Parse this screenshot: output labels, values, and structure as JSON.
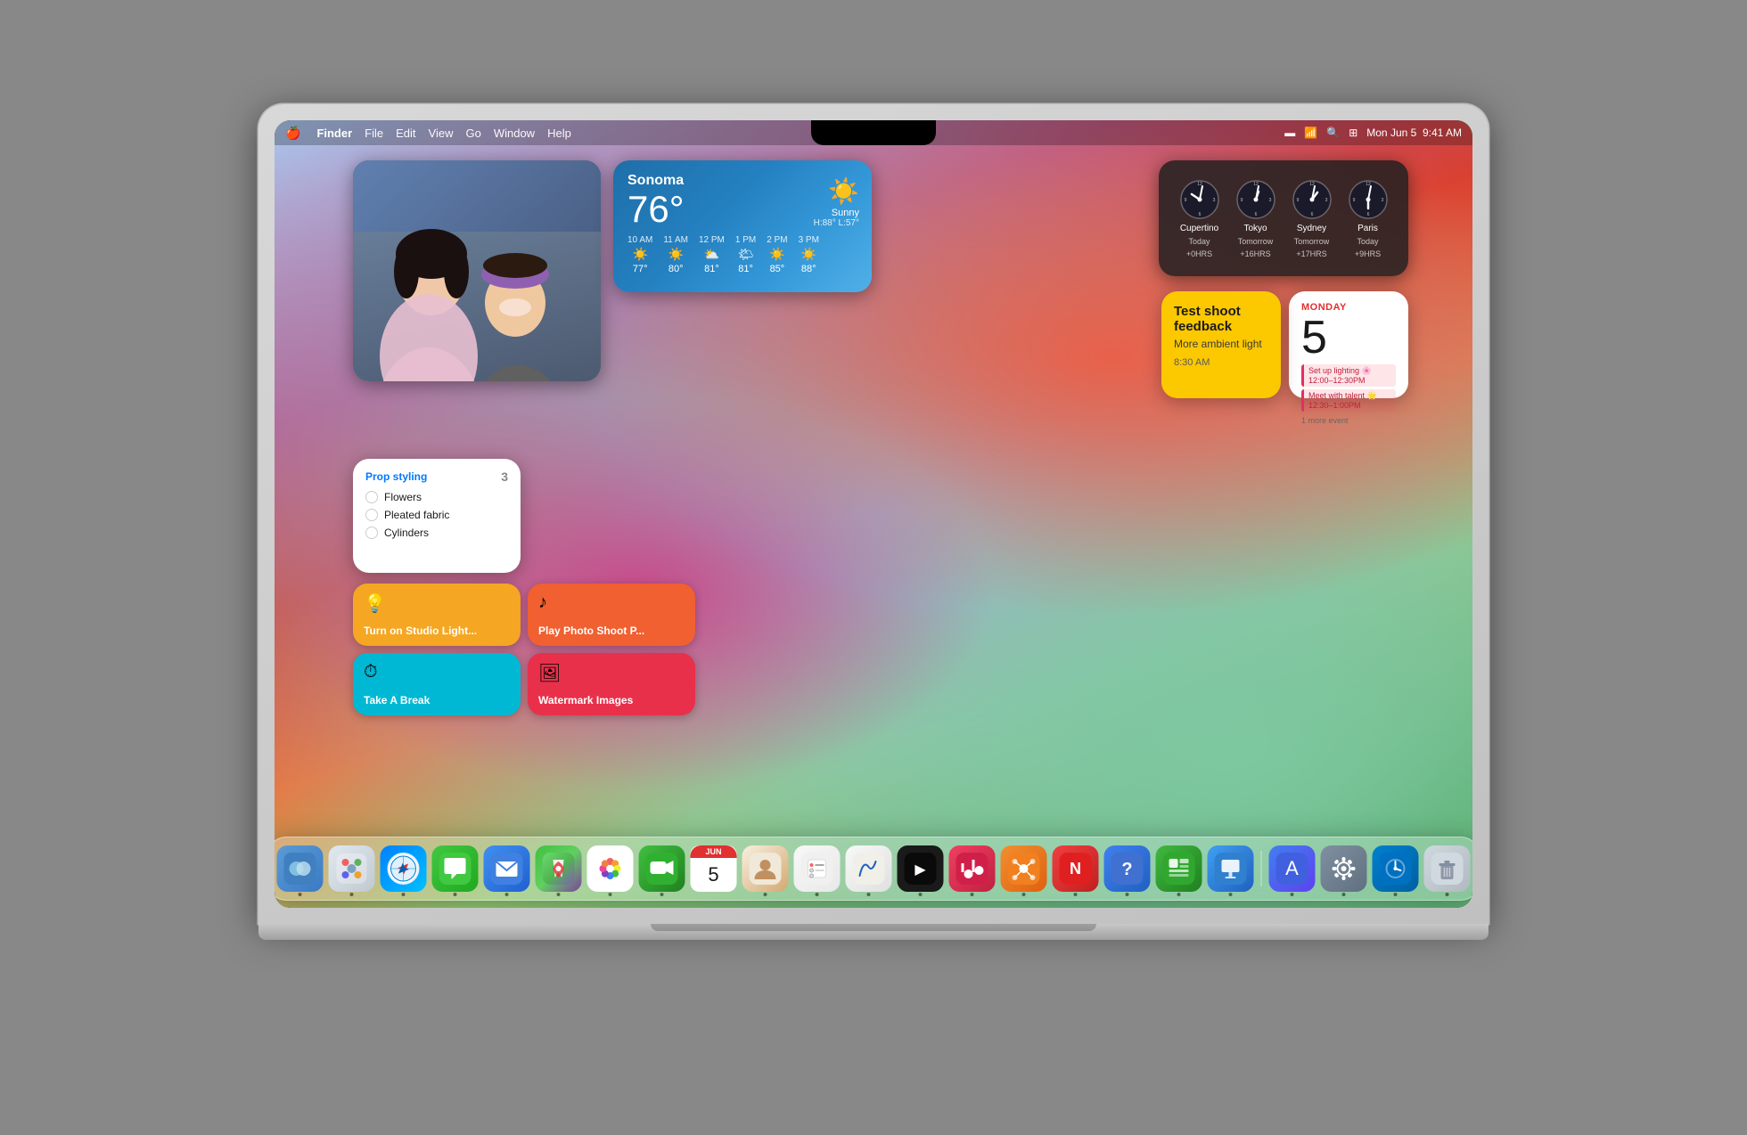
{
  "menubar": {
    "apple": "🍎",
    "app_name": "Finder",
    "items": [
      "File",
      "Edit",
      "View",
      "Go",
      "Window",
      "Help"
    ],
    "right_items": [
      "Mon Jun 5",
      "9:41 AM"
    ],
    "battery_icon": "battery-icon",
    "wifi_icon": "wifi-icon",
    "search_icon": "search-icon",
    "control_icon": "control-center-icon"
  },
  "widget_weather": {
    "city": "Sonoma",
    "temperature": "76°",
    "condition": "Sunny",
    "high": "H:88°",
    "low": "L:57°",
    "hours": [
      {
        "time": "10 AM",
        "icon": "☀️",
        "temp": "77°"
      },
      {
        "time": "11 AM",
        "icon": "☀️",
        "temp": "80°"
      },
      {
        "time": "12 PM",
        "icon": "⛅",
        "temp": "81°"
      },
      {
        "time": "1 PM",
        "icon": "🌤",
        "temp": "81°"
      },
      {
        "time": "2 PM",
        "icon": "☀️",
        "temp": "85°"
      },
      {
        "time": "3 PM",
        "icon": "☀️",
        "temp": "88°"
      }
    ]
  },
  "widget_clocks": {
    "clocks": [
      {
        "city": "Cupertino",
        "day": "Today",
        "offset": "+0HRS",
        "hour_angle": 280,
        "min_angle": 250
      },
      {
        "city": "Tokyo",
        "day": "Tomorrow",
        "offset": "+16HRS",
        "hour_angle": 100,
        "min_angle": 50
      },
      {
        "city": "Sydney",
        "day": "Tomorrow",
        "offset": "+17HRS",
        "hour_angle": 120,
        "min_angle": 70
      },
      {
        "city": "Paris",
        "day": "Today",
        "offset": "+9HRS",
        "hour_angle": 10,
        "min_angle": 250
      }
    ]
  },
  "widget_calendar": {
    "month": "MONDAY",
    "date": "5",
    "events": [
      {
        "name": "Set up lighting 🌸",
        "time": "12:00–12:30PM"
      },
      {
        "name": "Meet with talent 🌟",
        "time": "12:30–1:00PM"
      }
    ],
    "more": "1 more event"
  },
  "widget_notes": {
    "title": "Test shoot feedback",
    "subtitle": "More ambient light",
    "time": "8:30 AM"
  },
  "widget_reminders": {
    "title": "Prop styling",
    "count": "3",
    "items": [
      "Flowers",
      "Pleated fabric",
      "Cylinders"
    ]
  },
  "shortcuts": [
    {
      "label": "Turn on Studio Light...",
      "icon": "💡",
      "color": "shortcut-yellow"
    },
    {
      "label": "Play Photo Shoot P...",
      "icon": "♪",
      "color": "shortcut-orange"
    },
    {
      "label": "Take A Break",
      "icon": "⏱",
      "color": "shortcut-teal"
    },
    {
      "label": "Watermark Images",
      "icon": "🖼",
      "color": "shortcut-pink"
    }
  ],
  "dock": {
    "apps": [
      {
        "name": "Finder",
        "class": "dock-finder",
        "icon": "🔵"
      },
      {
        "name": "Launchpad",
        "class": "dock-launchpad",
        "icon": "⬡"
      },
      {
        "name": "Safari",
        "class": "dock-safari",
        "icon": "🧭"
      },
      {
        "name": "Messages",
        "class": "dock-messages",
        "icon": "💬"
      },
      {
        "name": "Mail",
        "class": "dock-mail",
        "icon": "✉️"
      },
      {
        "name": "Maps",
        "class": "dock-maps",
        "icon": "📍"
      },
      {
        "name": "Photos",
        "class": "dock-photos",
        "icon": "🌸"
      },
      {
        "name": "FaceTime",
        "class": "dock-facetime",
        "icon": "📹"
      },
      {
        "name": "Calendar",
        "class": "dock-calendar-app",
        "icon": "5",
        "special": true
      },
      {
        "name": "Contacts",
        "class": "dock-contacts",
        "icon": "👤"
      },
      {
        "name": "Reminders",
        "class": "dock-reminders",
        "icon": "✅"
      },
      {
        "name": "Freeform",
        "class": "dock-freeform",
        "icon": "✏️"
      },
      {
        "name": "Apple TV",
        "class": "dock-appletv",
        "icon": "📺"
      },
      {
        "name": "Music",
        "class": "dock-music",
        "icon": "♫"
      },
      {
        "name": "MindNode",
        "class": "dock-mindnode",
        "icon": "🔮"
      },
      {
        "name": "News",
        "class": "dock-news",
        "icon": "📰"
      },
      {
        "name": "Support",
        "class": "dock-support",
        "icon": "🔧"
      },
      {
        "name": "Numbers",
        "class": "dock-numbers",
        "icon": "📊"
      },
      {
        "name": "Keynote",
        "class": "dock-keynote",
        "icon": "📋"
      },
      {
        "name": "App Store",
        "class": "dock-appstore",
        "icon": "🅰"
      },
      {
        "name": "System Settings",
        "class": "dock-settings",
        "icon": "⚙️"
      },
      {
        "name": "Screen Time",
        "class": "dock-screentime",
        "icon": "⏰"
      },
      {
        "name": "Trash",
        "class": "dock-trash",
        "icon": "🗑"
      }
    ]
  }
}
